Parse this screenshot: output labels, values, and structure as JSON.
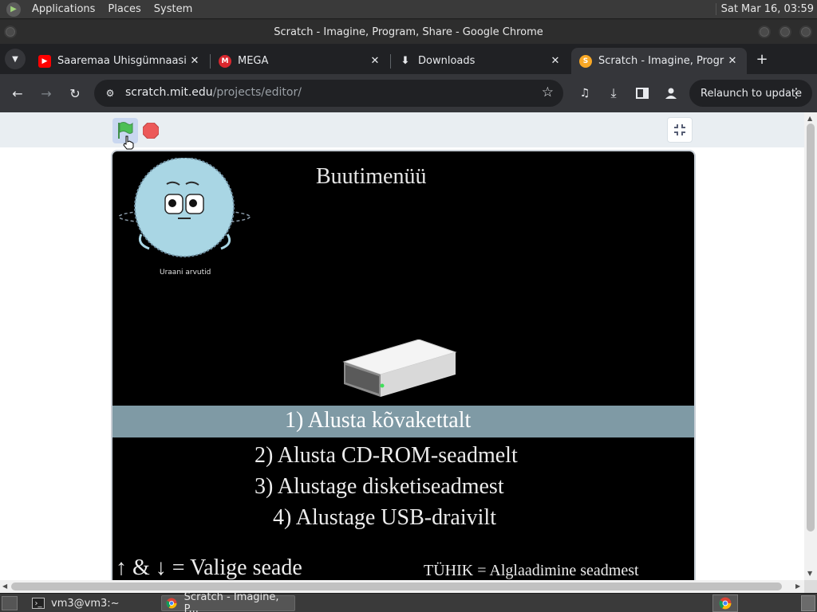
{
  "top_panel": {
    "menus": [
      "Applications",
      "Places",
      "System"
    ],
    "clock": "Sat Mar 16, 03:59"
  },
  "window": {
    "title": "Scratch - Imagine, Program, Share - Google Chrome"
  },
  "tabs": [
    {
      "label": "Saaremaa Ühisgümnaasium",
      "favicon": "youtube-icon",
      "color": "#ff0000",
      "active": false
    },
    {
      "label": "MEGA",
      "favicon": "mega-icon",
      "color": "#d9272e",
      "active": false
    },
    {
      "label": "Downloads",
      "favicon": "download-icon",
      "color": "#e8eaed",
      "active": false
    },
    {
      "label": "Scratch - Imagine, Program",
      "favicon": "scratch-icon",
      "color": "#f9a825",
      "active": true
    }
  ],
  "toolbar": {
    "url_host": "scratch.mit.edu",
    "url_path": "/projects/editor/",
    "relaunch_label": "Relaunch to update"
  },
  "stage": {
    "heading": "Buutimenüü",
    "mascot_label": "Uraani arvutid",
    "options": [
      "1) Alusta kõvakettalt",
      "2) Alusta CD-ROM-seadmelt",
      "3) Alustage disketiseadmest",
      "4) Alustage USB-draivilt"
    ],
    "selected_index": 0,
    "hint_left": "↑ & ↓ = Valige seade",
    "hint_right": "TÜHIK = Alglaadimine seadmest"
  },
  "taskbar": {
    "tasks": [
      {
        "label": "vm3@vm3:~",
        "icon": "terminal-icon"
      },
      {
        "label": "Scratch - Imagine, P...",
        "icon": "chrome-icon"
      }
    ]
  },
  "colors": {
    "selection_bar": "#7f9aa5",
    "green_flag": "#4cbf56",
    "stop": "#ec5959"
  }
}
